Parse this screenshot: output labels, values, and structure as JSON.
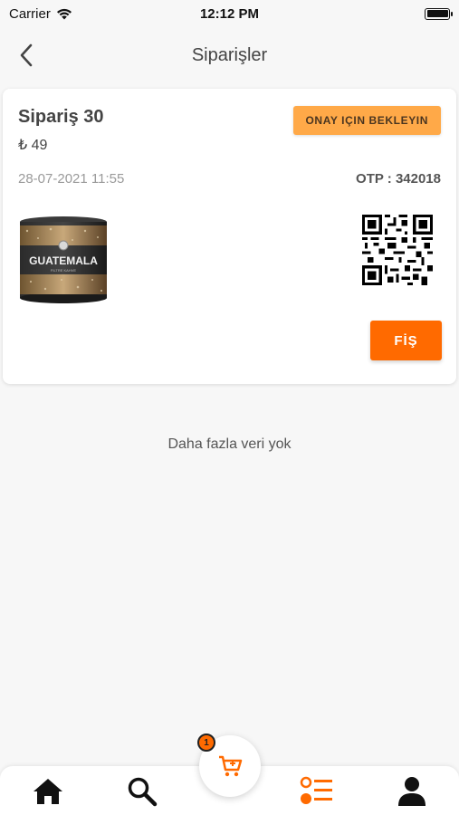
{
  "status_bar": {
    "carrier": "Carrier",
    "time": "12:12 PM"
  },
  "header": {
    "title": "Siparişler",
    "back_icon": "chevron-left-icon"
  },
  "order": {
    "title": "Sipariş 30",
    "price": "₺ 49",
    "status": "ONAY IÇIN BEKLEYIN",
    "date": "28-07-2021 11:55",
    "otp": "OTP : 342018",
    "product_label": "GUATEMALA",
    "product_sublabel": "FILTRE KAHVE",
    "receipt_button": "FİŞ"
  },
  "empty_message": "Daha fazla veri yok",
  "tab_bar": {
    "cart_badge": "1",
    "items": [
      "home-icon",
      "search-icon",
      "cart-icon",
      "orders-list-icon",
      "profile-icon"
    ]
  },
  "colors": {
    "accent": "#ff6a00",
    "badge_bg": "#ffa948",
    "background": "#f7f7f7"
  }
}
